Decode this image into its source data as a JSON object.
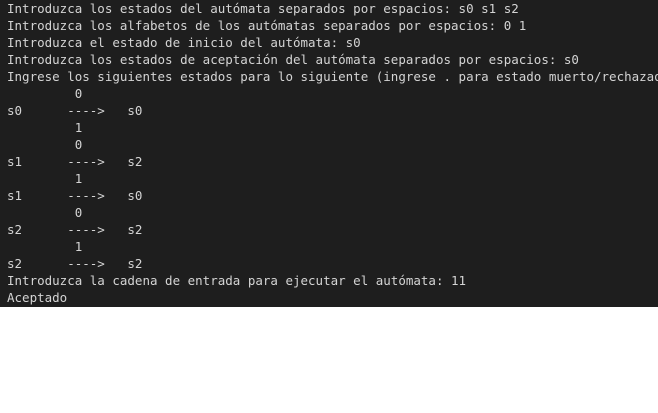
{
  "terminal": {
    "lines": [
      "Introduzca los estados del autómata separados por espacios: s0 s1 s2",
      "Introduzca los alfabetos de los autómatas separados por espacios: 0 1",
      "Introduzca el estado de inicio del autómata: s0",
      "Introduzca los estados de aceptación del autómata separados por espacios: s0",
      "Ingrese los siguientes estados para lo siguiente (ingrese . para estado muerto/rechazado)",
      "         0",
      "s0      ---->   s0",
      "         1",
      "         0",
      "s1      ---->   s2",
      "         1",
      "s1      ---->   s0",
      "         0",
      "s2      ---->   s2",
      "         1",
      "s2      ---->   s2",
      "Introduzca la cadena de entrada para ejecutar el autómata: 11",
      "Aceptado"
    ]
  }
}
